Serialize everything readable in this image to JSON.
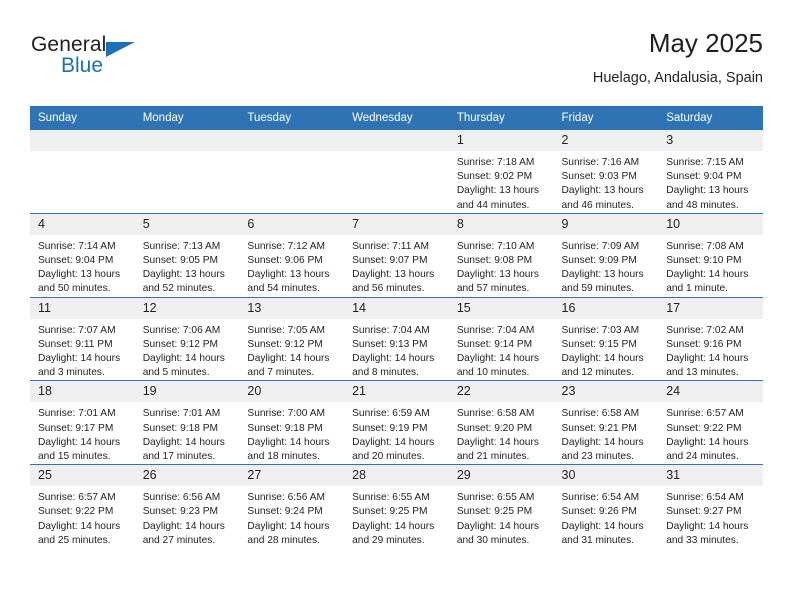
{
  "brand": {
    "name_top": "General",
    "name_bottom": "Blue",
    "accent_color": "#1f6fb6"
  },
  "header": {
    "title": "May 2025",
    "subtitle": "Huelago, Andalusia, Spain"
  },
  "theme": {
    "header_blue": "#2e74b5",
    "date_band": "#efefef",
    "text": "#231f20"
  },
  "weekday_headers": [
    "Sunday",
    "Monday",
    "Tuesday",
    "Wednesday",
    "Thursday",
    "Friday",
    "Saturday"
  ],
  "weeks": [
    [
      {
        "day": "",
        "empty": true,
        "sunrise": "",
        "sunset": "",
        "daylight_line1": "",
        "daylight_line2": ""
      },
      {
        "day": "",
        "empty": true,
        "sunrise": "",
        "sunset": "",
        "daylight_line1": "",
        "daylight_line2": ""
      },
      {
        "day": "",
        "empty": true,
        "sunrise": "",
        "sunset": "",
        "daylight_line1": "",
        "daylight_line2": ""
      },
      {
        "day": "",
        "empty": true,
        "sunrise": "",
        "sunset": "",
        "daylight_line1": "",
        "daylight_line2": ""
      },
      {
        "day": "1",
        "empty": false,
        "sunrise": "Sunrise: 7:18 AM",
        "sunset": "Sunset: 9:02 PM",
        "daylight_line1": "Daylight: 13 hours",
        "daylight_line2": "and 44 minutes."
      },
      {
        "day": "2",
        "empty": false,
        "sunrise": "Sunrise: 7:16 AM",
        "sunset": "Sunset: 9:03 PM",
        "daylight_line1": "Daylight: 13 hours",
        "daylight_line2": "and 46 minutes."
      },
      {
        "day": "3",
        "empty": false,
        "sunrise": "Sunrise: 7:15 AM",
        "sunset": "Sunset: 9:04 PM",
        "daylight_line1": "Daylight: 13 hours",
        "daylight_line2": "and 48 minutes."
      }
    ],
    [
      {
        "day": "4",
        "empty": false,
        "sunrise": "Sunrise: 7:14 AM",
        "sunset": "Sunset: 9:04 PM",
        "daylight_line1": "Daylight: 13 hours",
        "daylight_line2": "and 50 minutes."
      },
      {
        "day": "5",
        "empty": false,
        "sunrise": "Sunrise: 7:13 AM",
        "sunset": "Sunset: 9:05 PM",
        "daylight_line1": "Daylight: 13 hours",
        "daylight_line2": "and 52 minutes."
      },
      {
        "day": "6",
        "empty": false,
        "sunrise": "Sunrise: 7:12 AM",
        "sunset": "Sunset: 9:06 PM",
        "daylight_line1": "Daylight: 13 hours",
        "daylight_line2": "and 54 minutes."
      },
      {
        "day": "7",
        "empty": false,
        "sunrise": "Sunrise: 7:11 AM",
        "sunset": "Sunset: 9:07 PM",
        "daylight_line1": "Daylight: 13 hours",
        "daylight_line2": "and 56 minutes."
      },
      {
        "day": "8",
        "empty": false,
        "sunrise": "Sunrise: 7:10 AM",
        "sunset": "Sunset: 9:08 PM",
        "daylight_line1": "Daylight: 13 hours",
        "daylight_line2": "and 57 minutes."
      },
      {
        "day": "9",
        "empty": false,
        "sunrise": "Sunrise: 7:09 AM",
        "sunset": "Sunset: 9:09 PM",
        "daylight_line1": "Daylight: 13 hours",
        "daylight_line2": "and 59 minutes."
      },
      {
        "day": "10",
        "empty": false,
        "sunrise": "Sunrise: 7:08 AM",
        "sunset": "Sunset: 9:10 PM",
        "daylight_line1": "Daylight: 14 hours",
        "daylight_line2": "and 1 minute."
      }
    ],
    [
      {
        "day": "11",
        "empty": false,
        "sunrise": "Sunrise: 7:07 AM",
        "sunset": "Sunset: 9:11 PM",
        "daylight_line1": "Daylight: 14 hours",
        "daylight_line2": "and 3 minutes."
      },
      {
        "day": "12",
        "empty": false,
        "sunrise": "Sunrise: 7:06 AM",
        "sunset": "Sunset: 9:12 PM",
        "daylight_line1": "Daylight: 14 hours",
        "daylight_line2": "and 5 minutes."
      },
      {
        "day": "13",
        "empty": false,
        "sunrise": "Sunrise: 7:05 AM",
        "sunset": "Sunset: 9:12 PM",
        "daylight_line1": "Daylight: 14 hours",
        "daylight_line2": "and 7 minutes."
      },
      {
        "day": "14",
        "empty": false,
        "sunrise": "Sunrise: 7:04 AM",
        "sunset": "Sunset: 9:13 PM",
        "daylight_line1": "Daylight: 14 hours",
        "daylight_line2": "and 8 minutes."
      },
      {
        "day": "15",
        "empty": false,
        "sunrise": "Sunrise: 7:04 AM",
        "sunset": "Sunset: 9:14 PM",
        "daylight_line1": "Daylight: 14 hours",
        "daylight_line2": "and 10 minutes."
      },
      {
        "day": "16",
        "empty": false,
        "sunrise": "Sunrise: 7:03 AM",
        "sunset": "Sunset: 9:15 PM",
        "daylight_line1": "Daylight: 14 hours",
        "daylight_line2": "and 12 minutes."
      },
      {
        "day": "17",
        "empty": false,
        "sunrise": "Sunrise: 7:02 AM",
        "sunset": "Sunset: 9:16 PM",
        "daylight_line1": "Daylight: 14 hours",
        "daylight_line2": "and 13 minutes."
      }
    ],
    [
      {
        "day": "18",
        "empty": false,
        "sunrise": "Sunrise: 7:01 AM",
        "sunset": "Sunset: 9:17 PM",
        "daylight_line1": "Daylight: 14 hours",
        "daylight_line2": "and 15 minutes."
      },
      {
        "day": "19",
        "empty": false,
        "sunrise": "Sunrise: 7:01 AM",
        "sunset": "Sunset: 9:18 PM",
        "daylight_line1": "Daylight: 14 hours",
        "daylight_line2": "and 17 minutes."
      },
      {
        "day": "20",
        "empty": false,
        "sunrise": "Sunrise: 7:00 AM",
        "sunset": "Sunset: 9:18 PM",
        "daylight_line1": "Daylight: 14 hours",
        "daylight_line2": "and 18 minutes."
      },
      {
        "day": "21",
        "empty": false,
        "sunrise": "Sunrise: 6:59 AM",
        "sunset": "Sunset: 9:19 PM",
        "daylight_line1": "Daylight: 14 hours",
        "daylight_line2": "and 20 minutes."
      },
      {
        "day": "22",
        "empty": false,
        "sunrise": "Sunrise: 6:58 AM",
        "sunset": "Sunset: 9:20 PM",
        "daylight_line1": "Daylight: 14 hours",
        "daylight_line2": "and 21 minutes."
      },
      {
        "day": "23",
        "empty": false,
        "sunrise": "Sunrise: 6:58 AM",
        "sunset": "Sunset: 9:21 PM",
        "daylight_line1": "Daylight: 14 hours",
        "daylight_line2": "and 23 minutes."
      },
      {
        "day": "24",
        "empty": false,
        "sunrise": "Sunrise: 6:57 AM",
        "sunset": "Sunset: 9:22 PM",
        "daylight_line1": "Daylight: 14 hours",
        "daylight_line2": "and 24 minutes."
      }
    ],
    [
      {
        "day": "25",
        "empty": false,
        "sunrise": "Sunrise: 6:57 AM",
        "sunset": "Sunset: 9:22 PM",
        "daylight_line1": "Daylight: 14 hours",
        "daylight_line2": "and 25 minutes."
      },
      {
        "day": "26",
        "empty": false,
        "sunrise": "Sunrise: 6:56 AM",
        "sunset": "Sunset: 9:23 PM",
        "daylight_line1": "Daylight: 14 hours",
        "daylight_line2": "and 27 minutes."
      },
      {
        "day": "27",
        "empty": false,
        "sunrise": "Sunrise: 6:56 AM",
        "sunset": "Sunset: 9:24 PM",
        "daylight_line1": "Daylight: 14 hours",
        "daylight_line2": "and 28 minutes."
      },
      {
        "day": "28",
        "empty": false,
        "sunrise": "Sunrise: 6:55 AM",
        "sunset": "Sunset: 9:25 PM",
        "daylight_line1": "Daylight: 14 hours",
        "daylight_line2": "and 29 minutes."
      },
      {
        "day": "29",
        "empty": false,
        "sunrise": "Sunrise: 6:55 AM",
        "sunset": "Sunset: 9:25 PM",
        "daylight_line1": "Daylight: 14 hours",
        "daylight_line2": "and 30 minutes."
      },
      {
        "day": "30",
        "empty": false,
        "sunrise": "Sunrise: 6:54 AM",
        "sunset": "Sunset: 9:26 PM",
        "daylight_line1": "Daylight: 14 hours",
        "daylight_line2": "and 31 minutes."
      },
      {
        "day": "31",
        "empty": false,
        "sunrise": "Sunrise: 6:54 AM",
        "sunset": "Sunset: 9:27 PM",
        "daylight_line1": "Daylight: 14 hours",
        "daylight_line2": "and 33 minutes."
      }
    ]
  ]
}
